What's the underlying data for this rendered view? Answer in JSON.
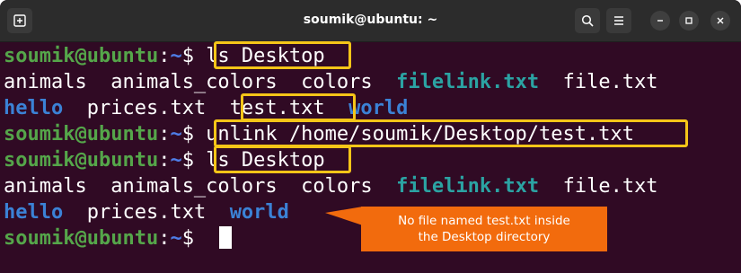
{
  "window": {
    "title": "soumik@ubuntu: ~"
  },
  "icons": {
    "new_tab": "new-tab-icon",
    "search": "search-icon",
    "menu": "hamburger-menu-icon",
    "minimize": "minimize-icon",
    "maximize": "maximize-icon",
    "close": "close-icon"
  },
  "prompt": {
    "user": "soumik@ubuntu",
    "sep": ":",
    "dir": "~",
    "sym": "$"
  },
  "lines": {
    "cmd1": "ls Desktop",
    "out1": {
      "a": "animals",
      "b": "animals_colors",
      "c": "colors",
      "d": "filelink.txt",
      "e": "file.txt"
    },
    "out2": {
      "a": "hello",
      "b": "prices.txt",
      "c": "test.txt",
      "d": "world"
    },
    "cmd2": "unlink /home/soumik/Desktop/test.txt",
    "cmd3": "ls Desktop",
    "out3": {
      "a": "animals",
      "b": "animals_colors",
      "c": "colors",
      "d": "filelink.txt",
      "e": "file.txt"
    },
    "out4": {
      "a": "hello",
      "b": "prices.txt",
      "c": "world"
    }
  },
  "callout": {
    "line1": "No file named test.txt inside",
    "line2": "the Desktop directory"
  },
  "colors": {
    "terminal_bg": "#300a24",
    "prompt_user": "#55a64a",
    "prompt_dir": "#4e7ee8",
    "directory": "#3b82d6",
    "symlink": "#2ba3a3",
    "highlight": "#f5c518",
    "callout_bg": "#f26b0d"
  }
}
